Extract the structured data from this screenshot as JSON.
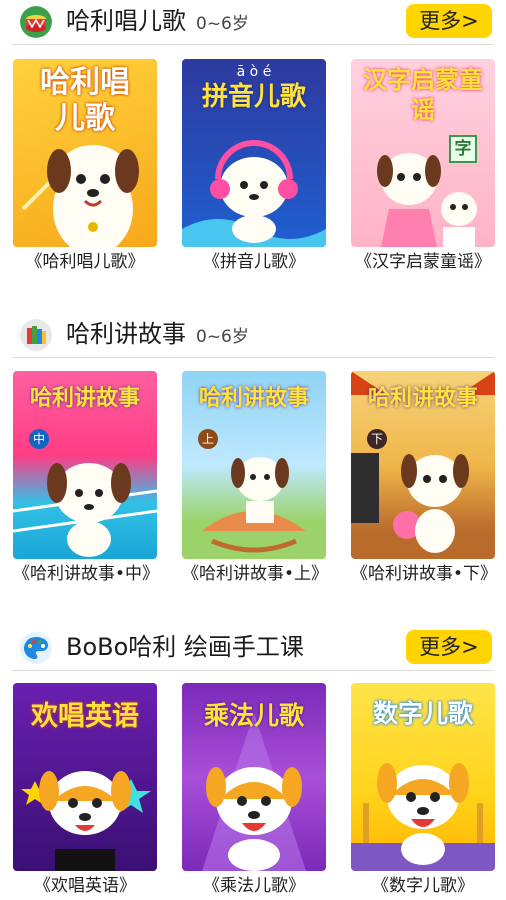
{
  "sections": [
    {
      "title": "哈利唱儿歌",
      "age": "0~6岁",
      "more": "更多>",
      "icon": "drum-icon",
      "items": [
        {
          "caption": "《哈利唱儿歌》",
          "cover_text": "哈利唱儿歌"
        },
        {
          "caption": "《拼音儿歌》",
          "cover_text": "拼音儿歌",
          "cover_sub": "ā ò é"
        },
        {
          "caption": "《汉字启蒙童谣》",
          "cover_text": "汉字启蒙童谣",
          "cover_badge": "字"
        }
      ]
    },
    {
      "title": "哈利讲故事",
      "age": "0~6岁",
      "icon": "books-icon",
      "items": [
        {
          "caption": "《哈利讲故事•中》",
          "cover_text": "哈利讲故事",
          "cover_badge": "中"
        },
        {
          "caption": "《哈利讲故事•上》",
          "cover_text": "哈利讲故事",
          "cover_badge": "上"
        },
        {
          "caption": "《哈利讲故事•下》",
          "cover_text": "哈利讲故事",
          "cover_badge": "下"
        }
      ]
    },
    {
      "title": "BoBo哈利 绘画手工课",
      "more": "更多>",
      "icon": "palette-icon",
      "items": [
        {
          "caption": "《欢唱英语》",
          "cover_text": "欢唱英语"
        },
        {
          "caption": "《乘法儿歌》",
          "cover_text": "乘法儿歌"
        },
        {
          "caption": "《数字儿歌》",
          "cover_text": "数字儿歌"
        }
      ]
    }
  ],
  "colors": {
    "accent": "#ffd400",
    "divider": "#dcdcdc"
  }
}
